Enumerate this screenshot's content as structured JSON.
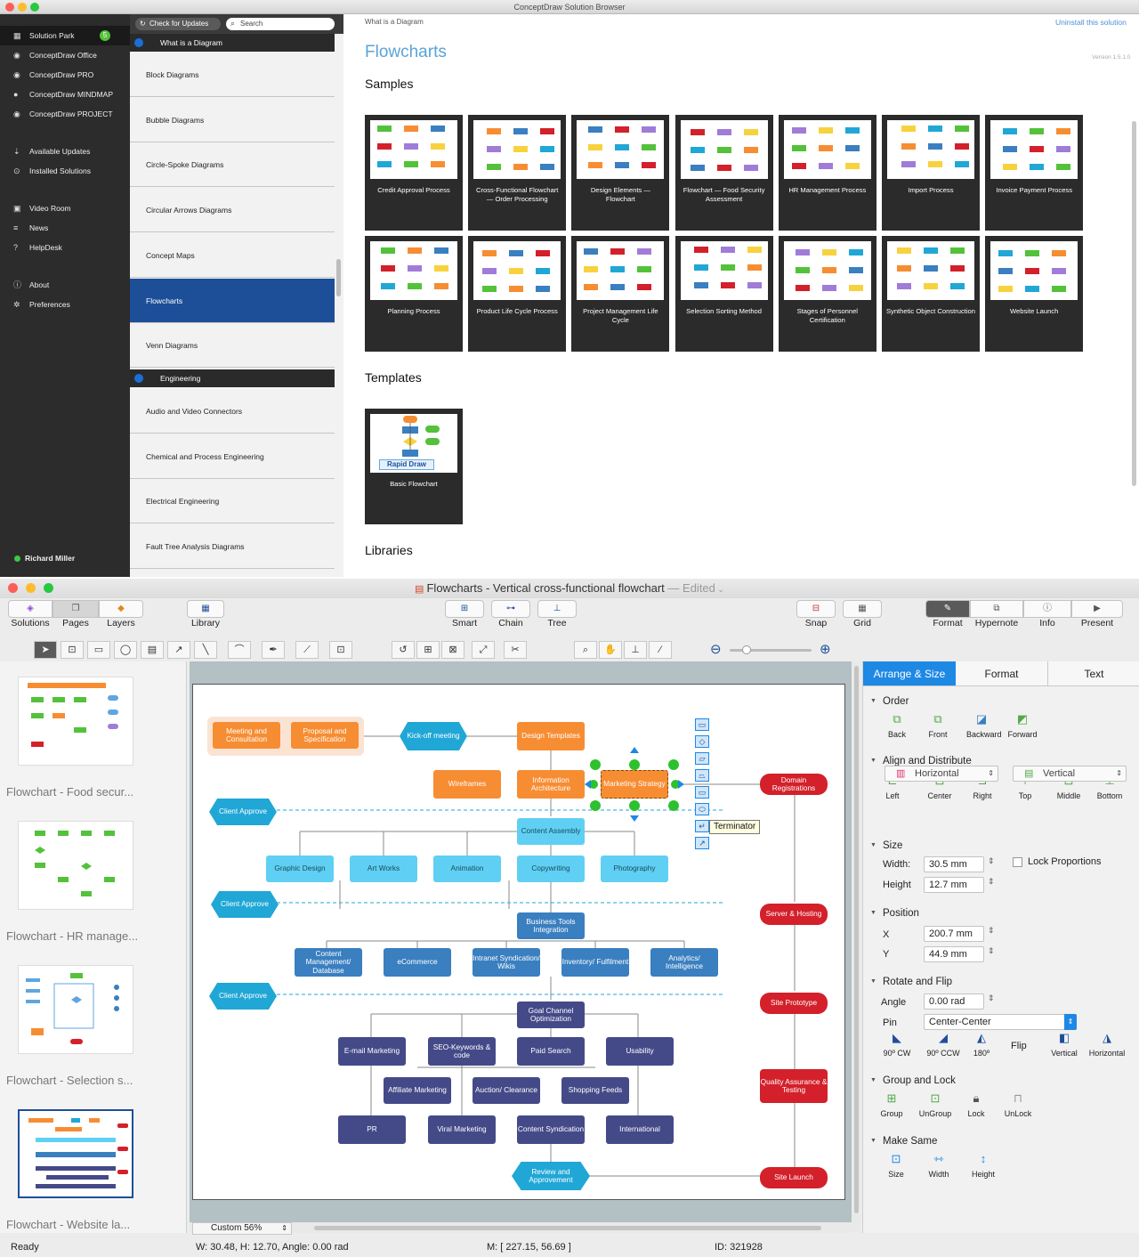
{
  "browser": {
    "title": "ConceptDraw Solution Browser",
    "check_updates": "Check for Updates",
    "search_placeholder": "Search",
    "breadcrumb": "What is a Diagram",
    "uninstall": "Uninstall this solution",
    "version": "Version 1.5.1.0",
    "heading": "Flowcharts",
    "samples_title": "Samples",
    "templates_title": "Templates",
    "libraries_title": "Libraries",
    "user": "Richard Miller",
    "nav": [
      {
        "label": "Solution Park",
        "icon": "grid-icon"
      },
      {
        "label": "ConceptDraw Office",
        "icon": "office-icon"
      },
      {
        "label": "ConceptDraw PRO",
        "icon": "pro-icon"
      },
      {
        "label": "ConceptDraw MINDMAP",
        "icon": "bulb-icon"
      },
      {
        "label": "ConceptDraw PROJECT",
        "icon": "project-icon"
      },
      {
        "label": "Available Updates",
        "icon": "updates-icon"
      },
      {
        "label": "Installed Solutions",
        "icon": "download-icon"
      },
      {
        "label": "Video Room",
        "icon": "video-icon"
      },
      {
        "label": "News",
        "icon": "list-icon"
      },
      {
        "label": "HelpDesk",
        "icon": "question-icon"
      },
      {
        "label": "About",
        "icon": "info-icon"
      },
      {
        "label": "Preferences",
        "icon": "gear-icon"
      }
    ],
    "section1": "What is a Diagram",
    "section2": "Engineering",
    "list1": [
      "Block Diagrams",
      "Bubble Diagrams",
      "Circle-Spoke Diagrams",
      "Circular Arrows Diagrams",
      "Concept Maps",
      "Flowcharts",
      "Venn Diagrams"
    ],
    "list2": [
      "Audio and Video Connectors",
      "Chemical and Process Engineering",
      "Electrical Engineering",
      "Fault Tree Analysis Diagrams"
    ],
    "samples": [
      "Credit Approval Process",
      "Cross-Functional Flowchart — Order Processing",
      "Design Elements — Flowchart",
      "Flowchart — Food Security Assessment",
      "HR Management Process",
      "Import Process",
      "Invoice Payment Process",
      "Planning Process",
      "Product Life Cycle Process",
      "Project Management Life Cycle",
      "Selection Sorting Method",
      "Stages of Personnel Certification",
      "Synthetic Object Construction",
      "Website Launch"
    ],
    "template": {
      "caption": "Basic Flowchart",
      "badge": "Rapid Draw"
    }
  },
  "editor": {
    "title": "Flowcharts - Vertical cross-functional flowchart",
    "edited": "— Edited",
    "toolbar_left": [
      "Solutions",
      "Pages",
      "Layers"
    ],
    "library": "Library",
    "toolbar_mid": [
      "Smart",
      "Chain",
      "Tree"
    ],
    "toolbar_right": [
      "Snap",
      "Grid"
    ],
    "toolbar_far": [
      "Format",
      "Hypernote",
      "Info",
      "Present"
    ],
    "pages": [
      "Flowchart - Food secur...",
      "Flowchart - HR manage...",
      "Flowchart - Selection s...",
      "Flowchart - Website la..."
    ],
    "zoom": "Custom 56%",
    "tooltip": "Terminator",
    "tabs": [
      "Arrange & Size",
      "Format",
      "Text"
    ],
    "order": {
      "title": "Order",
      "items": [
        "Back",
        "Front",
        "Backward",
        "Forward"
      ]
    },
    "align": {
      "title": "Align and Distribute",
      "items": [
        "Left",
        "Center",
        "Right",
        "Top",
        "Middle",
        "Bottom"
      ],
      "horizontal": "Horizontal",
      "vertical": "Vertical"
    },
    "size": {
      "title": "Size",
      "width_label": "Width:",
      "width": "30.5 mm",
      "height_label": "Height",
      "height": "12.7 mm",
      "lock": "Lock Proportions"
    },
    "position": {
      "title": "Position",
      "x_label": "X",
      "x": "200.7 mm",
      "y_label": "Y",
      "y": "44.9 mm"
    },
    "rotate": {
      "title": "Rotate and Flip",
      "angle_label": "Angle",
      "angle": "0.00 rad",
      "pin_label": "Pin",
      "pin": "Center-Center",
      "items": [
        "90º CW",
        "90º CCW",
        "180º"
      ],
      "flip": "Flip",
      "flip_items": [
        "Vertical",
        "Horizontal"
      ]
    },
    "group": {
      "title": "Group and Lock",
      "items": [
        "Group",
        "UnGroup",
        "Lock",
        "UnLock"
      ]
    },
    "same": {
      "title": "Make Same",
      "items": [
        "Size",
        "Width",
        "Height"
      ]
    },
    "status": {
      "ready": "Ready",
      "dims": "W: 30.48,  H: 12.70,  Angle: 0.00 rad",
      "mouse": "M: [ 227.15, 56.69 ]",
      "id": "ID: 321928"
    }
  },
  "diagram": {
    "nodes": {
      "meeting": "Meeting and Consultation",
      "proposal": "Proposal and Specification",
      "kickoff": "Kick-off meeting",
      "design": "Design Templates",
      "wireframes": "Wireframes",
      "infoarch": "Information Architecture",
      "marketing": "Marketing Strategy",
      "domain": "Domain Registrations",
      "client1": "Client Approve",
      "content": "Content Assembly",
      "graphic": "Graphic Design",
      "art": "Art Works",
      "animation": "Animation",
      "copy": "Copywriting",
      "photo": "Photography",
      "client2": "Client Approve",
      "server": "Server & Hosting",
      "bti": "Business Tools Integration",
      "cmd": "Content Management/ Database",
      "ecom": "eCommerce",
      "intranet": "Intranet Syndication/ Wikis",
      "inventory": "Inventory/ Fulfilment",
      "analytics": "Analytics/ Intelligence",
      "client3": "Client Approve",
      "prototype": "Site Prototype",
      "gco": "Goal Channel Optimization",
      "email": "E-mail Marketing",
      "seo": "SEO-Keywords & code",
      "paid": "Paid Search",
      "usability": "Usability",
      "affiliate": "Affiliate Marketing",
      "auction": "Auction/ Clearance",
      "shopping": "Shopping Feeds",
      "qa": "Quality Assurance & Testing",
      "pr": "PR",
      "viral": "Viral Marketing",
      "csynd": "Content Syndication",
      "intl": "International",
      "review": "Review and Approvement",
      "launch": "Site Launch"
    }
  },
  "colors": {
    "orange": "#f78d33",
    "cyan": "#5fd0f3",
    "blue": "#3a7fc0",
    "navy": "#444a88",
    "red": "#d3202a",
    "accent": "#1d4f99",
    "tab_active": "#1e88e5"
  }
}
